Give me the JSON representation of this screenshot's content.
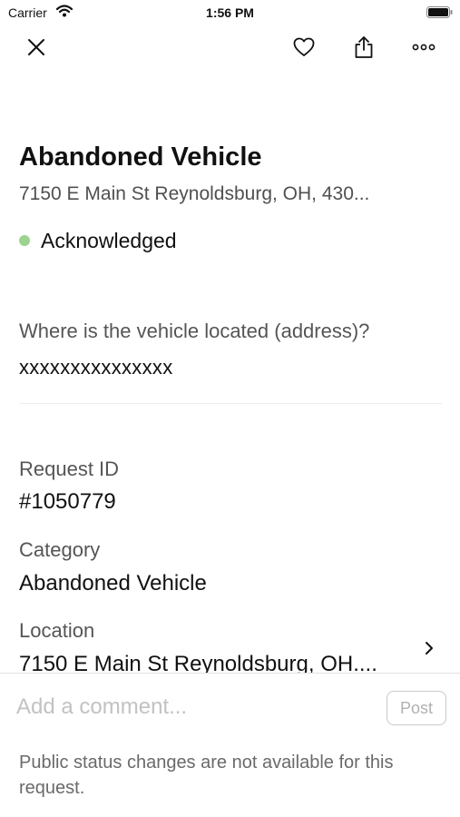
{
  "status_bar": {
    "carrier": "Carrier",
    "time": "1:56 PM"
  },
  "nav": {
    "icons": [
      "close-icon",
      "heart-icon",
      "share-icon",
      "more-icon"
    ]
  },
  "request": {
    "title": "Abandoned Vehicle",
    "address": "7150 E Main St Reynoldsburg, OH, 430...",
    "status": "Acknowledged",
    "status_color": "#9bd38f"
  },
  "question": {
    "label": "Where is the vehicle located (address)?",
    "answer": "xxxxxxxxxxxxxxx"
  },
  "details": {
    "request_id_label": "Request ID",
    "request_id_value": "#1050779",
    "category_label": "Category",
    "category_value": "Abandoned Vehicle",
    "location_label": "Location",
    "location_value": "7150 E Main St Reynoldsburg, OH...."
  },
  "comment": {
    "placeholder": "Add a comment...",
    "post_label": "Post",
    "notice": "Public status changes are not available for this request."
  }
}
